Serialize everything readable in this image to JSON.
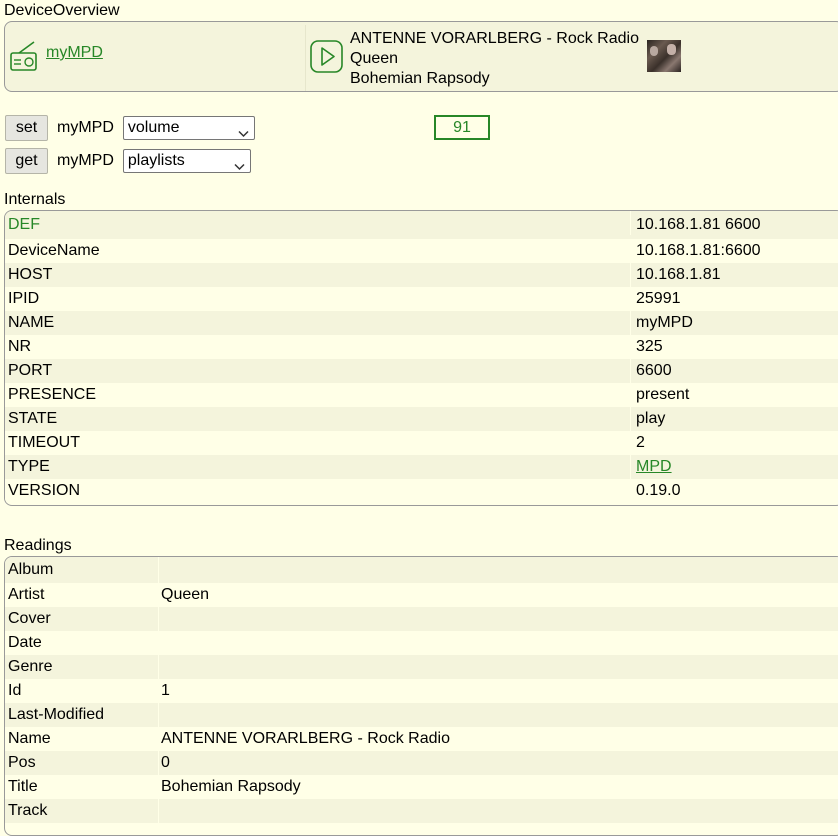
{
  "overview": {
    "title": "DeviceOverview",
    "device_name": "myMPD",
    "station": "ANTENNE VORARLBERG - Rock Radio",
    "artist": "Queen",
    "title_track": "Bohemian Rapsody"
  },
  "commands": {
    "set_label": "set",
    "get_label": "get",
    "device": "myMPD",
    "set_value": "volume",
    "get_value": "playlists",
    "volume": "91"
  },
  "internals": {
    "title": "Internals",
    "rows": [
      {
        "key": "DEF",
        "value": "10.168.1.81 6600"
      },
      {
        "key": "DeviceName",
        "value": "10.168.1.81:6600"
      },
      {
        "key": "HOST",
        "value": "10.168.1.81"
      },
      {
        "key": "IPID",
        "value": "25991"
      },
      {
        "key": "NAME",
        "value": "myMPD"
      },
      {
        "key": "NR",
        "value": "325"
      },
      {
        "key": "PORT",
        "value": "6600"
      },
      {
        "key": "PRESENCE",
        "value": "present"
      },
      {
        "key": "STATE",
        "value": "play"
      },
      {
        "key": "TIMEOUT",
        "value": "2"
      },
      {
        "key": "TYPE",
        "value": "MPD"
      },
      {
        "key": "VERSION",
        "value": "0.19.0"
      }
    ]
  },
  "readings": {
    "title": "Readings",
    "rows": [
      {
        "key": "Album",
        "value": ""
      },
      {
        "key": "Artist",
        "value": "Queen"
      },
      {
        "key": "Cover",
        "value": ""
      },
      {
        "key": "Date",
        "value": ""
      },
      {
        "key": "Genre",
        "value": ""
      },
      {
        "key": "Id",
        "value": "1"
      },
      {
        "key": "Last-Modified",
        "value": ""
      },
      {
        "key": "Name",
        "value": "ANTENNE VORARLBERG - Rock Radio"
      },
      {
        "key": "Pos",
        "value": "0"
      },
      {
        "key": "Title",
        "value": "Bohemian Rapsody"
      },
      {
        "key": "Track",
        "value": ""
      }
    ]
  },
  "colors": {
    "accent": "#278727",
    "background": "#ffffe7",
    "row_alt": "#f4f4dc"
  }
}
